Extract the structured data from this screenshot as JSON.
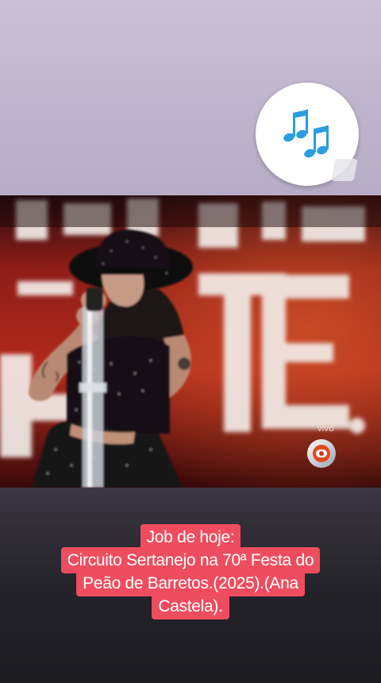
{
  "story": {
    "sticker": {
      "icon": "music-notes-icon",
      "color": "#2a9ee0"
    },
    "video": {
      "backdrop_text": "PATES",
      "live_label": "VIVO",
      "broadcaster_icon": "globo-logo-icon"
    },
    "caption": {
      "lines": [
        "Job de hoje:",
        "Circuito Sertanejo na 70ª Festa do",
        "Peão de Barretos.(2025).(Ana",
        "Castela)."
      ],
      "background": "#ee4d5f"
    }
  }
}
